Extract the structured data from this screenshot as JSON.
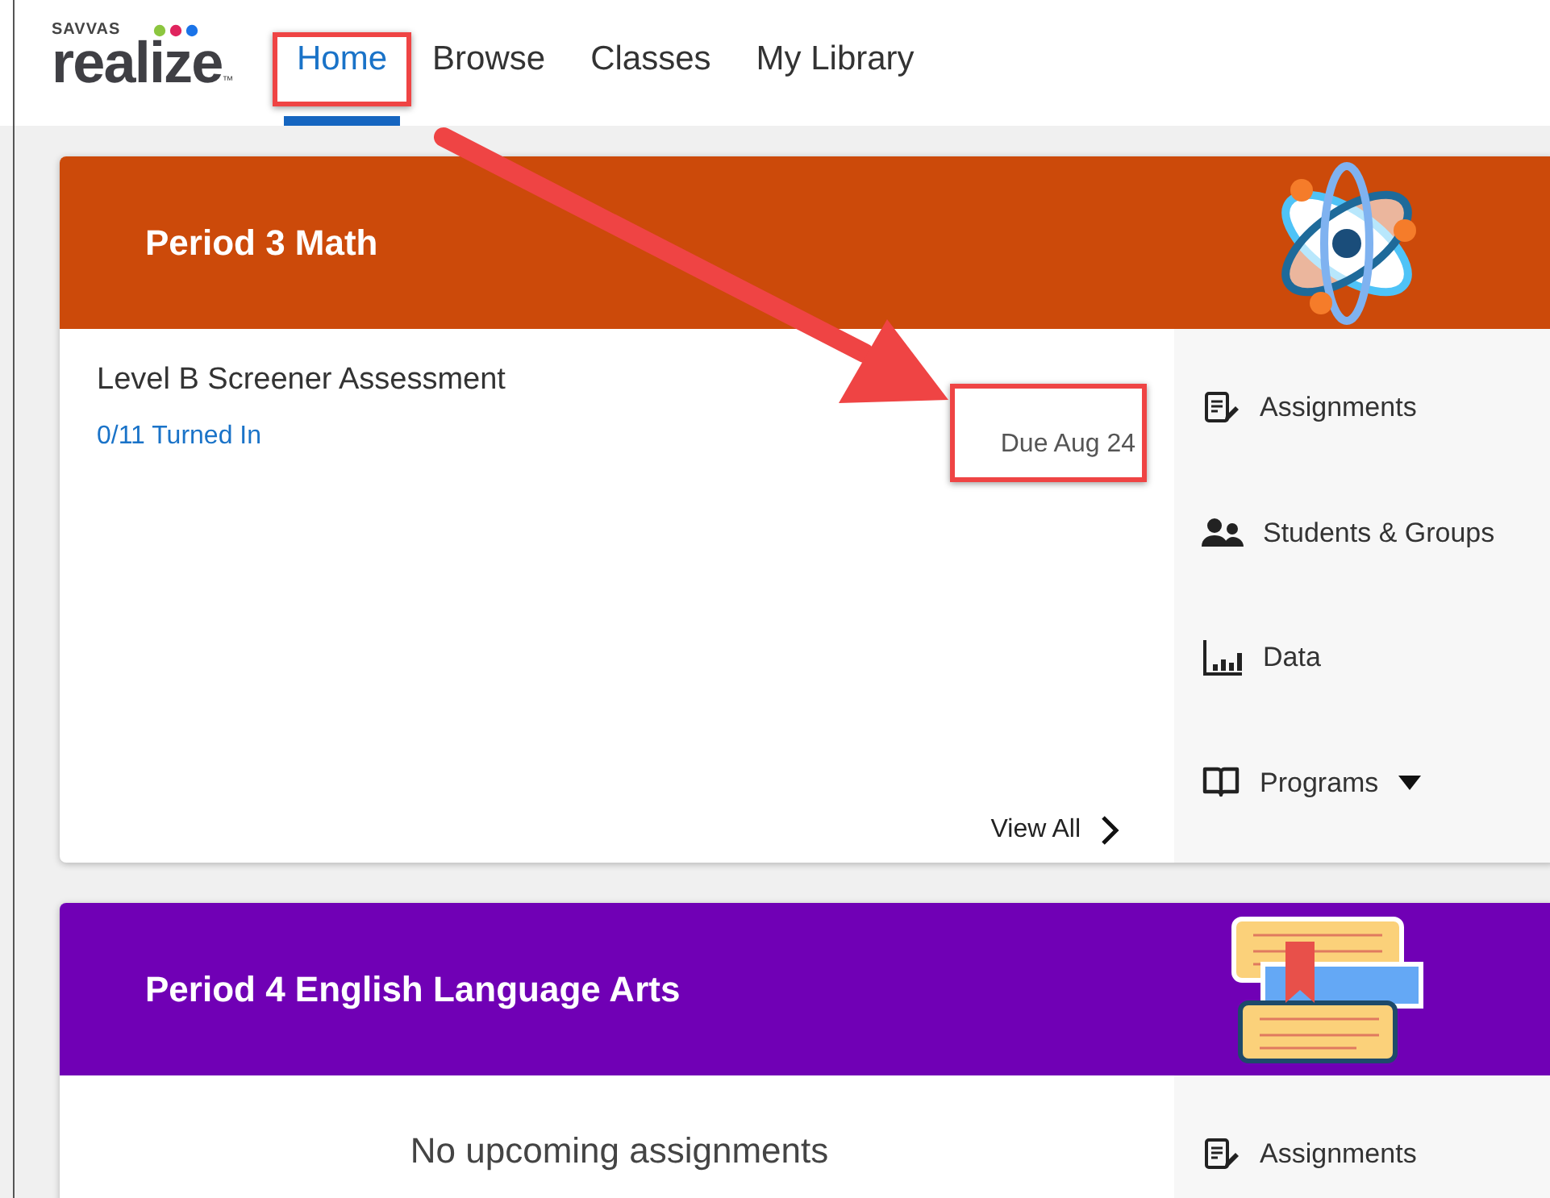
{
  "logo": {
    "brand": "SAVVAS",
    "name": "realize",
    "mark": "™"
  },
  "nav": [
    {
      "label": "Home",
      "selected": true
    },
    {
      "label": "Browse",
      "selected": false
    },
    {
      "label": "Classes",
      "selected": false
    },
    {
      "label": "My Library",
      "selected": false
    }
  ],
  "classes": [
    {
      "title": "Period 3 Math",
      "color": "#cc4a0a",
      "kind": "atom",
      "assignments": [
        {
          "name": "Level B Screener Assessment",
          "status": "0/11 Turned In",
          "due": "Due Aug 24"
        }
      ],
      "view_all": "View All",
      "links": [
        {
          "kind": "assignments",
          "label": "Assignments"
        },
        {
          "kind": "students",
          "label": "Students & Groups"
        },
        {
          "kind": "data",
          "label": "Data"
        },
        {
          "kind": "programs",
          "label": "Programs"
        }
      ]
    },
    {
      "title": "Period 4 English Language Arts",
      "color": "#7000b5",
      "kind": "books",
      "empty_message": "No upcoming assignments",
      "links": [
        {
          "kind": "assignments",
          "label": "Assignments"
        }
      ]
    }
  ]
}
